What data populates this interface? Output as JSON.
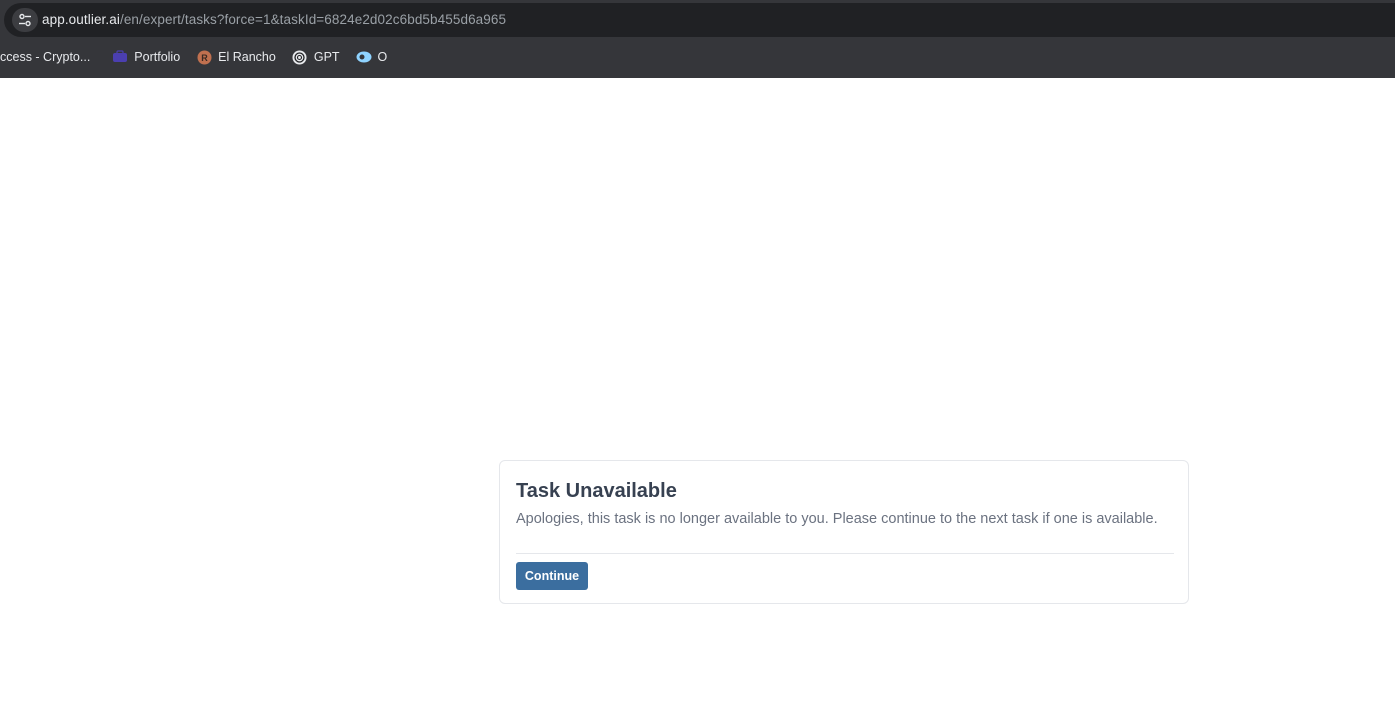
{
  "browser": {
    "url_host": "app.outlier.ai",
    "url_path": "/en/expert/tasks?force=1&taskId=6824e2d02c6bd5b455d6a965",
    "site_info_icon": "tune-icon",
    "bookmarks": [
      {
        "label": "ccess - Crypto...",
        "icon": "none"
      },
      {
        "label": "Portfolio",
        "icon": "portfolio-icon",
        "color": "#4b3fb0"
      },
      {
        "label": "El Rancho",
        "icon": "letter-r-icon",
        "color": "#c0704f"
      },
      {
        "label": "GPT",
        "icon": "openai-icon",
        "color": "#e8eaed"
      },
      {
        "label": "O",
        "icon": "o-icon",
        "color": "#8fd3ff"
      }
    ]
  },
  "card": {
    "title": "Task Unavailable",
    "message": "Apologies, this task is no longer available to you. Please continue to the next task if one is available.",
    "button_label": "Continue"
  },
  "colors": {
    "button": "#3b6e9f",
    "title": "#374151",
    "message": "#6b7280"
  }
}
